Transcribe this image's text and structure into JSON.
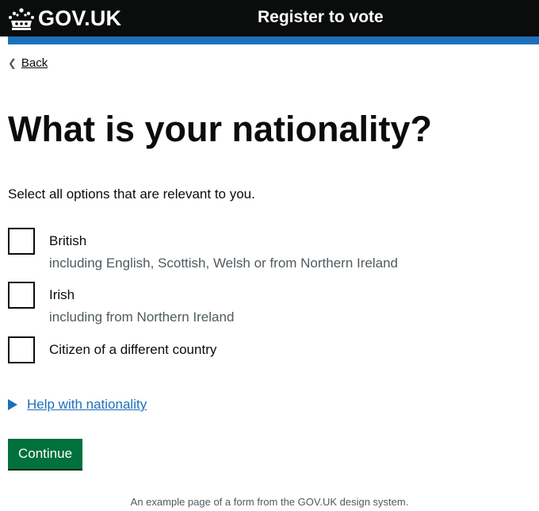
{
  "header": {
    "logo_text": "GOV.UK",
    "service_name": "Register to vote",
    "crown_icon": "crown-icon"
  },
  "back_link": {
    "label": "Back",
    "icon": "chevron-left-icon"
  },
  "question": {
    "heading": "What is your nationality?",
    "hint": "Select all options that are relevant to you."
  },
  "options": [
    {
      "label": "British",
      "hint": "including English, Scottish, Welsh or from Northern Ireland",
      "checked": false
    },
    {
      "label": "Irish",
      "hint": "including from Northern Ireland",
      "checked": false
    },
    {
      "label": "Citizen of a different country",
      "hint": "",
      "checked": false
    }
  ],
  "details": {
    "summary": "Help with nationality",
    "icon": "triangle-right-icon"
  },
  "continue_button": {
    "label": "Continue"
  },
  "footer": {
    "note": "An example page of a form from the GOV.UK design system."
  },
  "colors": {
    "header_bg": "#0b0c0c",
    "brand_blue": "#1d70b8",
    "button_green": "#00703c",
    "text": "#0b0c0c",
    "secondary_text": "#505a5f"
  }
}
